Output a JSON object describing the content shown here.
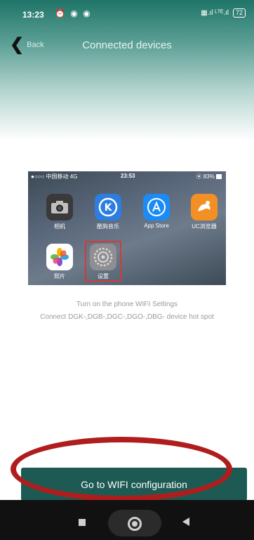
{
  "status_bar": {
    "time": "13:23",
    "icons_left": "⏰ ◉ ◉",
    "network": "▦.ıl ᴸᵀᴱ.ıl",
    "battery": "72"
  },
  "nav": {
    "back_label": "Back",
    "title": "Connected devices"
  },
  "phone_screen": {
    "status_left": "●○○○ 中国移动 4G",
    "status_time": "23:53",
    "status_right": "⦿ 83% ▇",
    "apps": [
      {
        "label": "相机",
        "icon": "camera-icon",
        "color": "#3a3a3a"
      },
      {
        "label": "酷狗音乐",
        "icon": "kugou-icon",
        "color": "#2c7ee0"
      },
      {
        "label": "App Store",
        "icon": "app-store-icon",
        "color": "#1b8cf5"
      },
      {
        "label": "UC浏览器",
        "icon": "uc-browser-icon",
        "color": "#f29025"
      },
      {
        "label": "照片",
        "icon": "photos-icon",
        "color": "#ffffff"
      },
      {
        "label": "设置",
        "icon": "settings-icon",
        "color": "#8e8e93"
      }
    ]
  },
  "instructions": {
    "line1": "Turn on the phone WIFI Settings",
    "line2": "Connect DGK-,DGB-,DGC-,DGO-,DBG- device hot spot"
  },
  "cta": {
    "label": "Go to WIFI configuration",
    "color": "#1d5a53"
  },
  "annotation_color": "#b01d1d"
}
